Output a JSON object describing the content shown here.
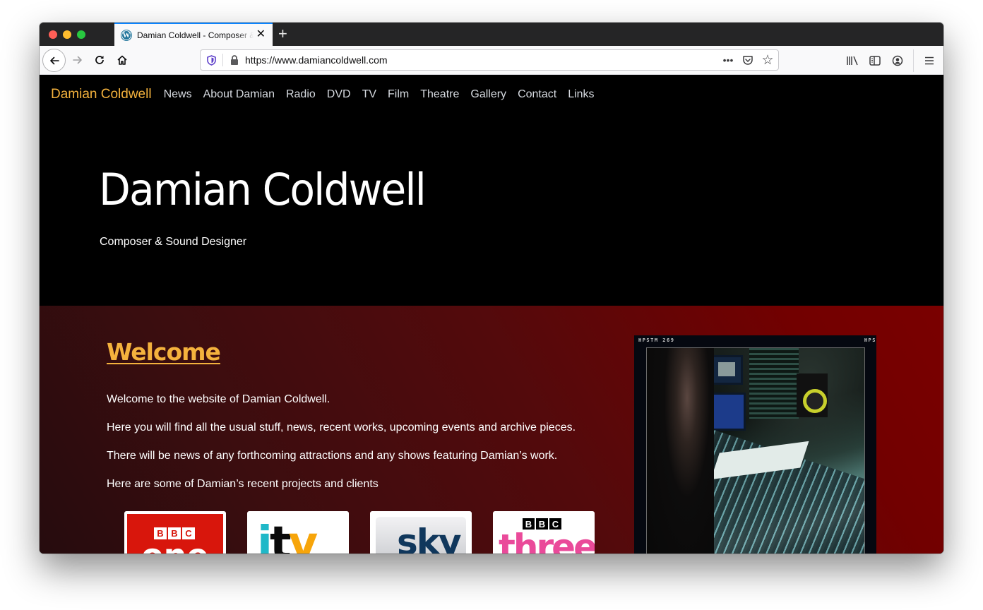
{
  "browser": {
    "tab": {
      "title": "Damian Coldwell - Composer & Sound Designer",
      "favicon": "wordpress-icon",
      "close_glyph": "✕"
    },
    "new_tab_glyph": "+",
    "url": "https://www.damiancoldwell.com",
    "toolbar_icons": [
      "back-arrow-icon",
      "forward-arrow-icon",
      "reload-icon",
      "home-icon"
    ],
    "url_icons": [
      "tracking-shield-icon",
      "lock-icon"
    ],
    "url_actions": {
      "more": "•••",
      "pocket": "pocket-icon",
      "bookmark": "☆"
    },
    "right_tools": [
      "library-icon",
      "sidebar-icon",
      "account-icon",
      "menu-icon"
    ]
  },
  "site": {
    "brand": "Damian Coldwell",
    "nav": [
      "News",
      "About Damian",
      "Radio",
      "DVD",
      "TV",
      "Film",
      "Theatre",
      "Gallery",
      "Contact",
      "Links"
    ],
    "hero": {
      "title": "Damian Coldwell",
      "subtitle": "Composer & Sound Designer"
    },
    "welcome": {
      "heading": "Welcome",
      "paragraphs": [
        "Welcome to the website of Damian Coldwell.",
        "Here you will find all the usual stuff, news, recent works, upcoming events and archive pieces.",
        "There will be news of any forthcoming attractions and any shows featuring Damian’s work.",
        "Here are some of Damian’s recent projects and clients"
      ]
    },
    "clients": [
      {
        "name": "BBC One",
        "letters": [
          "B",
          "B",
          "C"
        ],
        "word": "one"
      },
      {
        "name": "ITV",
        "letters": [
          "i",
          "t",
          "v"
        ]
      },
      {
        "name": "Sky",
        "word": "sky"
      },
      {
        "name": "BBC Three",
        "letters": [
          "B",
          "B",
          "C"
        ],
        "word": "three"
      }
    ],
    "photo": {
      "caption_left": "HPSTM 269",
      "caption_right": "HPS",
      "alt": "Damian Coldwell at a mixing console in a studio"
    },
    "colors": {
      "brand_accent": "#f4b23d",
      "nav_text": "#d6dae0",
      "hero_bg": "#000000",
      "content_gradient_start": "#260c0e",
      "content_gradient_end": "#7a0000"
    }
  }
}
